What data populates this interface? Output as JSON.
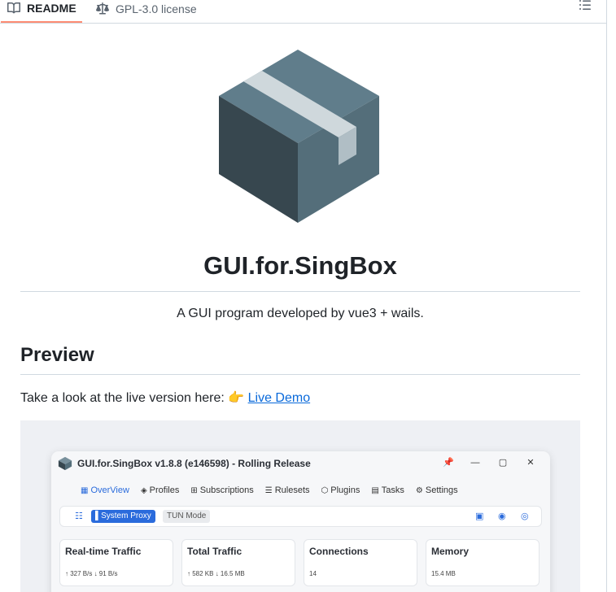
{
  "tabs": {
    "readme": "README",
    "license": "GPL-3.0 license"
  },
  "icons": {
    "readme": "book-icon",
    "license": "law-icon",
    "outline": "list-unordered-icon",
    "app_logo": "box-icon"
  },
  "colors": {
    "accent": "#0969da",
    "active_tab_underline": "#fd8c73",
    "logo_box": "#546e7a",
    "app_accent": "#2a6bdc"
  },
  "readme": {
    "title": "GUI.for.SingBox",
    "description": "A GUI program developed by vue3 + wails.",
    "preview_heading": "Preview",
    "live_text": "Take a look at the live version here: 👉 ",
    "live_link": "Live Demo"
  },
  "screenshot": {
    "window_title": "GUI.for.SingBox v1.8.8 (e146598) - Rolling Release",
    "window_controls": [
      "📌",
      "—",
      "▢",
      "✕"
    ],
    "nav": [
      {
        "icon": "▦",
        "label": "OverView"
      },
      {
        "icon": "◈",
        "label": "Profiles"
      },
      {
        "icon": "⊞",
        "label": "Subscriptions"
      },
      {
        "icon": "☰",
        "label": "Rulesets"
      },
      {
        "icon": "⬡",
        "label": "Plugins"
      },
      {
        "icon": "▤",
        "label": "Tasks"
      },
      {
        "icon": "⚙",
        "label": "Settings"
      }
    ],
    "system_proxy": "System Proxy",
    "tun_mode": "TUN Mode",
    "cards": [
      {
        "title": "Real-time Traffic",
        "value": "↑ 327 B/s ↓ 91 B/s"
      },
      {
        "title": "Total Traffic",
        "value": "↑ 582 KB ↓ 16.5 MB"
      },
      {
        "title": "Connections",
        "value": "14"
      },
      {
        "title": "Memory",
        "value": "15.4 MB"
      }
    ]
  }
}
